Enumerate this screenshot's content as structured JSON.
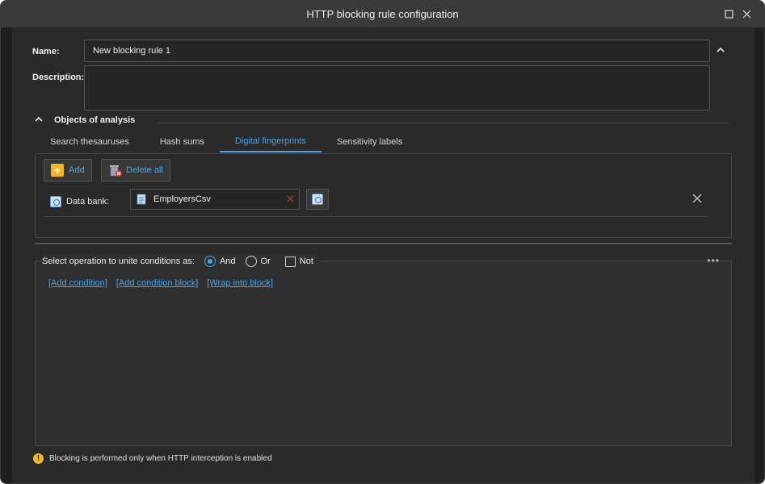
{
  "window": {
    "title": "HTTP blocking rule configuration",
    "max_icon": "maximize-icon",
    "close_icon": "close-icon"
  },
  "form": {
    "name_label": "Name:",
    "name_value": "New blocking rule 1",
    "description_label": "Description:",
    "description_value": ""
  },
  "section": {
    "title": "Objects of analysis",
    "tabs": [
      {
        "label": "Search thesauruses",
        "active": false
      },
      {
        "label": "Hash sums",
        "active": false
      },
      {
        "label": "Digital fingerprints",
        "active": true
      },
      {
        "label": "Sensitivity labels",
        "active": false
      }
    ]
  },
  "toolbar": {
    "add_label": "Add",
    "delete_all_label": "Delete all"
  },
  "databank": {
    "label": "Data bank:",
    "value": "EmployersCsv"
  },
  "conditions": {
    "prompt": "Select operation to unite conditions as:",
    "and_label": "And",
    "or_label": "Or",
    "not_label": "Not",
    "selected": "And",
    "more": "•••",
    "links": [
      "[Add condition]",
      "[Add condition block]",
      "[Wrap into block]"
    ]
  },
  "footer": {
    "warning": "Blocking is performed only when HTTP interception is enabled"
  },
  "colors": {
    "accent": "#4aa3e8",
    "background": "#2a2a2a",
    "warning": "#f1b724"
  }
}
